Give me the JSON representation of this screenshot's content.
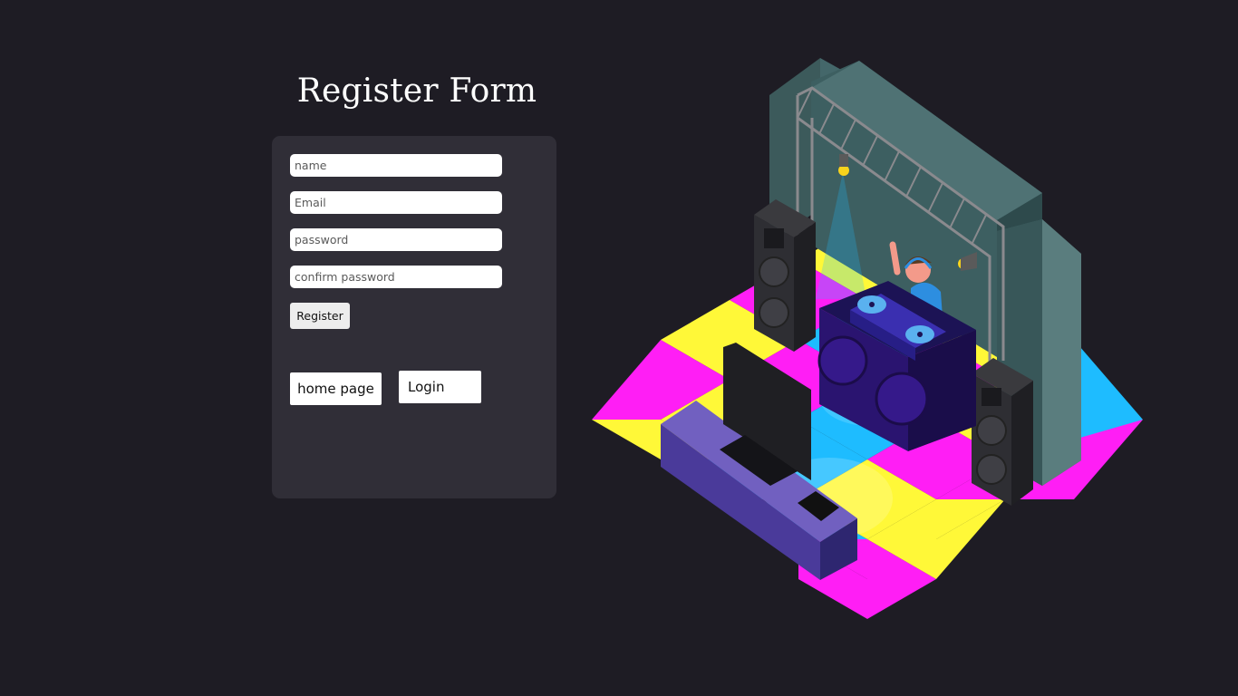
{
  "page": {
    "title": "Register Form"
  },
  "form": {
    "name_placeholder": "name",
    "email_placeholder": "Email",
    "password_placeholder": "password",
    "confirm_placeholder": "confirm password",
    "register_label": "Register"
  },
  "nav": {
    "home_label": "home page",
    "login_label": "Login"
  },
  "colors": {
    "background": "#1e1c24",
    "panel": "#302e37",
    "tile_magenta": "#ff1ef5",
    "tile_yellow": "#fff838",
    "tile_cyan": "#1ebcff"
  },
  "illustration": {
    "icon": "dj-stage-illustration"
  }
}
